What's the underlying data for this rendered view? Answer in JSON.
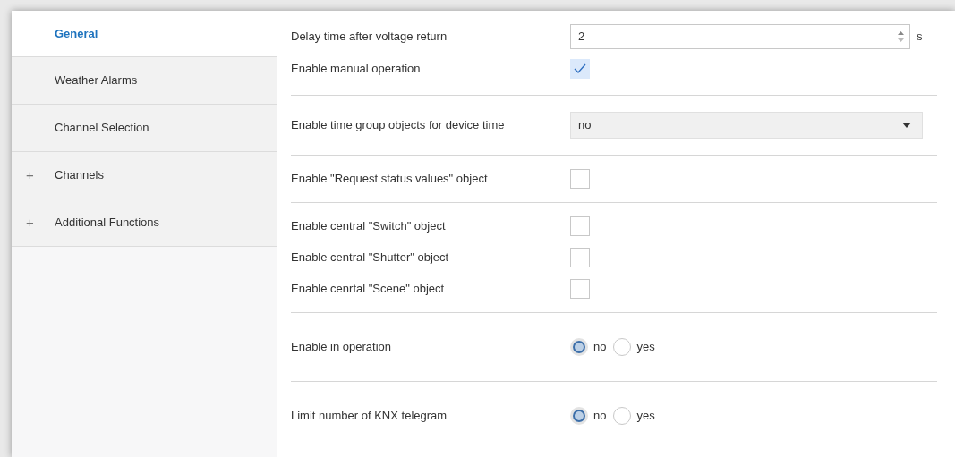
{
  "sidebar": {
    "items": [
      {
        "label": "General",
        "selected": true
      },
      {
        "label": "Weather Alarms",
        "selected": false
      },
      {
        "label": "Channel Selection",
        "selected": false
      },
      {
        "label": "Channels",
        "selected": false,
        "expander": "+"
      },
      {
        "label": "Additional Functions",
        "selected": false,
        "expander": "+"
      }
    ]
  },
  "sections": [
    {
      "rows": [
        {
          "kind": "number",
          "label": "Delay time after voltage return",
          "value": "2",
          "unit": "s"
        },
        {
          "kind": "checkbox",
          "label": "Enable manual operation",
          "checked": true
        }
      ]
    },
    {
      "rows": [
        {
          "kind": "dropdown",
          "label": "Enable time group objects for device time",
          "value": "no"
        }
      ]
    },
    {
      "rows": [
        {
          "kind": "checkbox",
          "label": "Enable \"Request status values\" object",
          "checked": false
        }
      ]
    },
    {
      "rows": [
        {
          "kind": "checkbox",
          "label": "Enable central \"Switch\" object",
          "checked": false
        },
        {
          "kind": "checkbox",
          "label": "Enable central \"Shutter\" object",
          "checked": false
        },
        {
          "kind": "checkbox",
          "label": "Enable cenrtal \"Scene\" object",
          "checked": false
        }
      ]
    },
    {
      "rows": [
        {
          "kind": "radio",
          "label": "Enable in operation",
          "options": [
            {
              "label": "no",
              "selected": true
            },
            {
              "label": "yes",
              "selected": false
            }
          ]
        }
      ]
    },
    {
      "rows": [
        {
          "kind": "radio",
          "label": "Limit number of KNX telegram",
          "options": [
            {
              "label": "no",
              "selected": true
            },
            {
              "label": "yes",
              "selected": false
            }
          ]
        }
      ]
    }
  ]
}
